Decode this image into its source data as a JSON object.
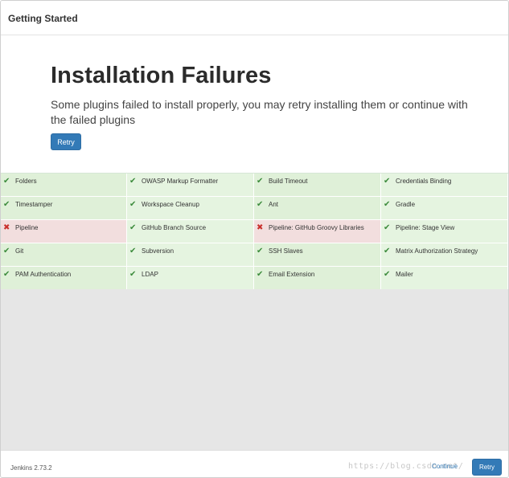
{
  "header": {
    "title": "Getting Started"
  },
  "hero": {
    "heading": "Installation Failures",
    "description": "Some plugins failed to install properly, you may retry installing them or continue with the failed plugins",
    "retry_label": "Retry"
  },
  "plugins": [
    {
      "name": "Folders",
      "status": "success"
    },
    {
      "name": "OWASP Markup Formatter",
      "status": "success"
    },
    {
      "name": "Build Timeout",
      "status": "success"
    },
    {
      "name": "Credentials Binding",
      "status": "success"
    },
    {
      "name": "Timestamper",
      "status": "success"
    },
    {
      "name": "Workspace Cleanup",
      "status": "success"
    },
    {
      "name": "Ant",
      "status": "success"
    },
    {
      "name": "Gradle",
      "status": "success"
    },
    {
      "name": "Pipeline",
      "status": "failure"
    },
    {
      "name": "GitHub Branch Source",
      "status": "success"
    },
    {
      "name": "Pipeline: GitHub Groovy Libraries",
      "status": "failure"
    },
    {
      "name": "Pipeline: Stage View",
      "status": "success"
    },
    {
      "name": "Git",
      "status": "success"
    },
    {
      "name": "Subversion",
      "status": "success"
    },
    {
      "name": "SSH Slaves",
      "status": "success"
    },
    {
      "name": "Matrix Authorization Strategy",
      "status": "success"
    },
    {
      "name": "PAM Authentication",
      "status": "success"
    },
    {
      "name": "LDAP",
      "status": "success"
    },
    {
      "name": "Email Extension",
      "status": "success"
    },
    {
      "name": "Mailer",
      "status": "success"
    }
  ],
  "icons": {
    "success": "check-icon",
    "failure": "cross-icon"
  },
  "colors": {
    "success_bg": "#dff0d8",
    "failure_bg": "#f2dede",
    "primary": "#337ab7"
  },
  "footer": {
    "version": "Jenkins 2.73.2",
    "watermark": "https://blog.csdn.net/",
    "continue_label": "Continue",
    "retry_label": "Retry"
  }
}
